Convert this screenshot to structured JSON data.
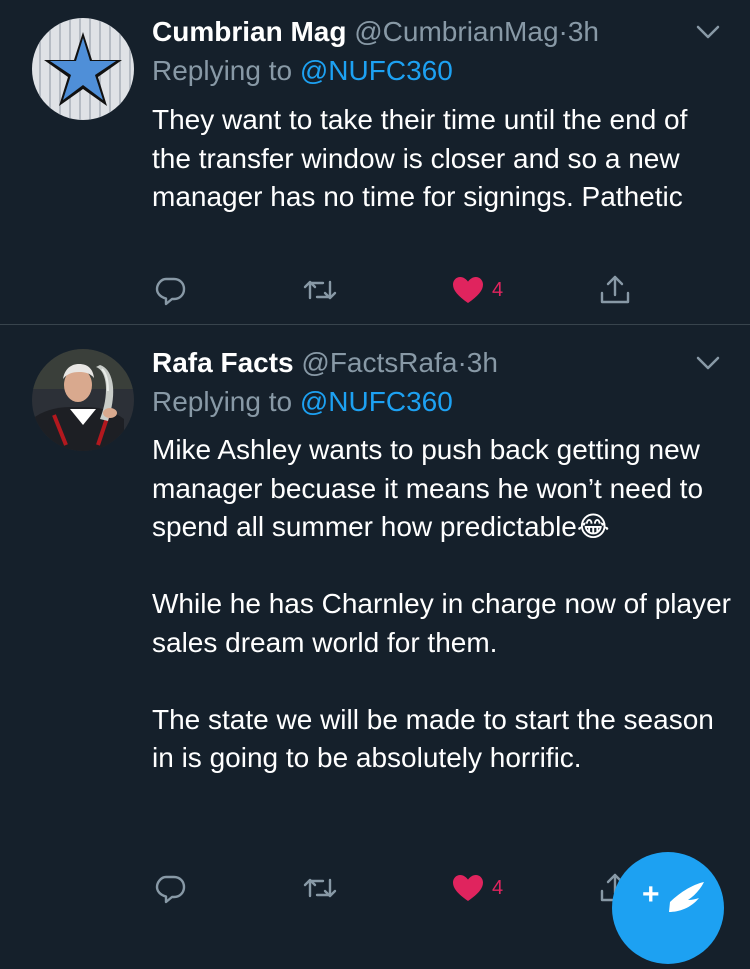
{
  "colors": {
    "background": "#15202b",
    "text": "#ffffff",
    "muted": "#8899a6",
    "link": "#1da1f2",
    "like": "#e0245e",
    "divider": "#38444d"
  },
  "tweets": [
    {
      "name": "Cumbrian Mag",
      "handle": "@CumbrianMag",
      "separator": "·",
      "time": "3h",
      "replying_prefix": "Replying to",
      "replying_to": "@NUFC360",
      "body": [
        "They want to take their time until the end of the transfer window is closer and so a new manager has no time for signings. Pathetic"
      ],
      "likes": "4",
      "avatar_icon": "star-avatar",
      "liked": true
    },
    {
      "name": "Rafa Facts",
      "handle": "@FactsRafa",
      "separator": "·",
      "time": "3h",
      "replying_prefix": "Replying to",
      "replying_to": "@NUFC360",
      "body": [
        "Mike Ashley wants to push back getting new manager becuase it means he won’t need to spend all summer how predictable😂",
        "While he has Charnley in charge now of player sales dream world for them.",
        "The state we will be made to start the season in is going to be absolutely horrific."
      ],
      "likes": "4",
      "avatar_icon": "person-trophy-avatar",
      "liked": true
    }
  ],
  "fab": {
    "label": "+",
    "icon": "compose-feather-icon"
  }
}
